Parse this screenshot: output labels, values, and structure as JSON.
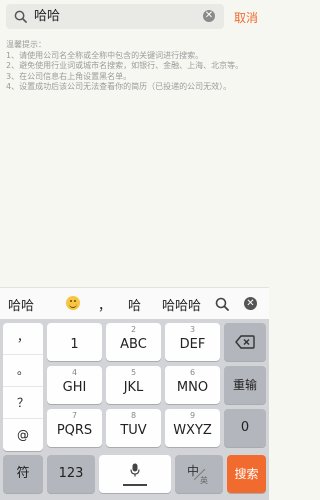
{
  "search": {
    "query": "哈哈",
    "cancel_label": "取消"
  },
  "tips": {
    "title": "温馨提示：",
    "lines": [
      "1、请使用公司名全称或全称中包含的关键词进行搜索。",
      "2、避免使用行业词或城市名搜索，如银行、金融、上海、北京等。",
      "3、在公司信息右上角设置黑名单。",
      "4、设置成功后该公司无法查看你的简历（已投递的公司无效）。"
    ]
  },
  "candidates": {
    "c1": "哈哈",
    "c2": "，",
    "c3": "哈",
    "c4": "哈哈哈"
  },
  "keyboard": {
    "symbols": [
      "，",
      "。",
      "？",
      "@"
    ],
    "keys": {
      "k1": {
        "num": "",
        "label": "1"
      },
      "k2": {
        "num": "2",
        "label": "ABC"
      },
      "k3": {
        "num": "3",
        "label": "DEF"
      },
      "k4": {
        "num": "4",
        "label": "GHI"
      },
      "k5": {
        "num": "5",
        "label": "JKL"
      },
      "k6": {
        "num": "6",
        "label": "MNO"
      },
      "k7": {
        "num": "7",
        "label": "PQRS"
      },
      "k8": {
        "num": "8",
        "label": "TUV"
      },
      "k9": {
        "num": "9",
        "label": "WXYZ"
      },
      "k0": {
        "label": "0"
      }
    },
    "reenter_label": "重输",
    "symbol_label": "符",
    "num_label": "123",
    "lang_main": "中",
    "lang_sub": "英",
    "enter_label": "搜索"
  },
  "colors": {
    "accent": "#f26b2e",
    "background": "#f7f7f2",
    "keyboard_bg": "#d2d4d8"
  }
}
